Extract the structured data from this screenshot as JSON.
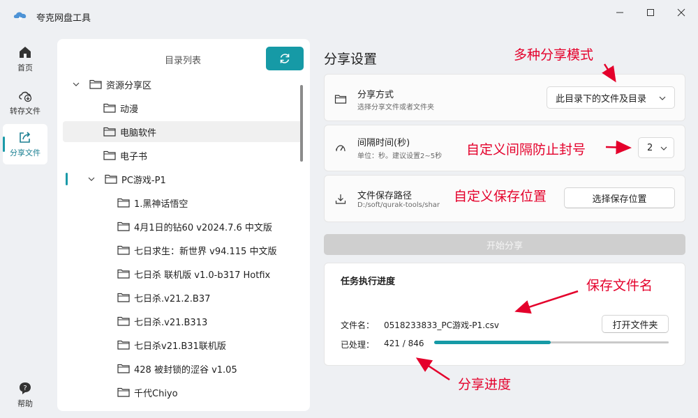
{
  "app": {
    "title": "夸克网盘工具"
  },
  "nav": {
    "home": "首页",
    "transfer": "转存文件",
    "share": "分享文件",
    "help": "帮助"
  },
  "tree": {
    "header": "目录列表",
    "items": [
      {
        "label": "资源分享区",
        "level": 0,
        "expanded": true
      },
      {
        "label": "动漫",
        "level": 1
      },
      {
        "label": "电脑软件",
        "level": 1,
        "selected": true
      },
      {
        "label": "电子书",
        "level": 1
      },
      {
        "label": "PC游戏-P1",
        "level": 1,
        "expanded": true,
        "focus": true
      },
      {
        "label": "1.黑神话悟空",
        "level": 2
      },
      {
        "label": "4月1日的钻60 v2024.7.6 中文版",
        "level": 2
      },
      {
        "label": "七日求生：新世界 v94.115 中文版",
        "level": 2
      },
      {
        "label": "七日杀 联机版 v1.0-b317 Hotfix",
        "level": 2
      },
      {
        "label": "七日杀.v21.2.B37",
        "level": 2
      },
      {
        "label": "七日杀.v21.B313",
        "level": 2
      },
      {
        "label": "七日杀v21.B31联机版",
        "level": 2
      },
      {
        "label": "428 被封锁的涩谷 v1.05",
        "level": 2
      },
      {
        "label": "千代Chiyo",
        "level": 2
      }
    ]
  },
  "settings": {
    "title": "分享设置",
    "mode": {
      "label": "分享方式",
      "desc": "选择分享文件或者文件夹",
      "value": "此目录下的文件及目录"
    },
    "interval": {
      "label": "间隔时间(秒)",
      "desc": "单位：秒。建议设置2~5秒",
      "value": "2"
    },
    "path": {
      "label": "文件保存路径",
      "desc": "D:/soft/qurak-tools/shar",
      "button": "选择保存位置"
    },
    "start_button": "开始分享"
  },
  "progress": {
    "title": "任务执行进度",
    "filename_label": "文件名：",
    "filename": "0518233833_PC游戏-P1.csv",
    "open_folder": "打开文件夹",
    "processed_label": "已处理：",
    "processed": "421 / 846",
    "done": 421,
    "total": 846
  },
  "annotations": {
    "mode": "多种分享模式",
    "interval": "自定义间隔防止封号",
    "path": "自定义保存位置",
    "filename": "保存文件名",
    "progress": "分享进度"
  },
  "colors": {
    "accent": "#169aa6",
    "annotation": "#e4002b"
  }
}
